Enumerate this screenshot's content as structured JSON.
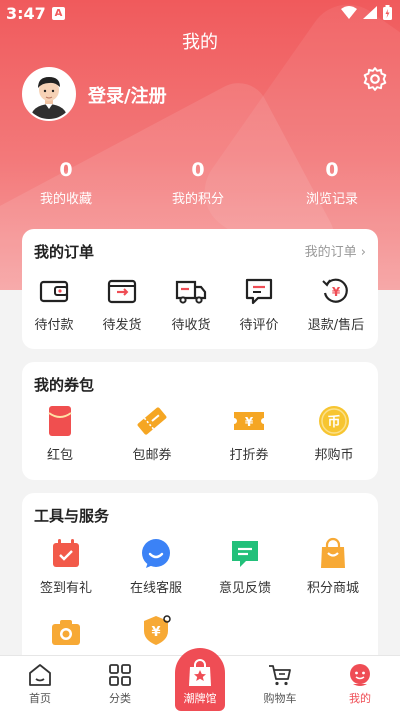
{
  "status_bar": {
    "time": "3:47",
    "notification_badge": "A"
  },
  "header": {
    "title": "我的",
    "login_text": "登录/注册"
  },
  "stats": [
    {
      "value": "0",
      "label": "我的收藏"
    },
    {
      "value": "0",
      "label": "我的积分"
    },
    {
      "value": "0",
      "label": "浏览记录"
    }
  ],
  "orders": {
    "title": "我的订单",
    "more": "我的订单",
    "items": [
      {
        "label": "待付款",
        "icon": "wallet-icon"
      },
      {
        "label": "待发货",
        "icon": "box-icon"
      },
      {
        "label": "待收货",
        "icon": "truck-icon"
      },
      {
        "label": "待评价",
        "icon": "comment-icon"
      },
      {
        "label": "退款/售后",
        "icon": "refund-icon"
      }
    ]
  },
  "coupons": {
    "title": "我的券包",
    "items": [
      {
        "label": "红包",
        "icon": "red-packet-icon"
      },
      {
        "label": "包邮券",
        "icon": "shipping-coupon-icon"
      },
      {
        "label": "打折券",
        "icon": "discount-coupon-icon"
      },
      {
        "label": "邦购币",
        "icon": "coin-icon",
        "glyph": "币"
      }
    ]
  },
  "tools": {
    "title": "工具与服务",
    "items": [
      {
        "label": "签到有礼",
        "icon": "calendar-icon"
      },
      {
        "label": "在线客服",
        "icon": "chat-icon"
      },
      {
        "label": "意见反馈",
        "icon": "feedback-icon"
      },
      {
        "label": "积分商城",
        "icon": "shopping-bag-icon"
      },
      {
        "label": "",
        "icon": "camera-icon"
      },
      {
        "label": "",
        "icon": "yuan-badge-icon"
      }
    ]
  },
  "tabbar": {
    "items": [
      {
        "label": "首页",
        "icon": "home-icon"
      },
      {
        "label": "分类",
        "icon": "grid-icon"
      },
      {
        "label": "潮牌馆",
        "icon": "star-bag-icon"
      },
      {
        "label": "购物车",
        "icon": "cart-icon"
      },
      {
        "label": "我的",
        "icon": "profile-icon"
      }
    ]
  },
  "colors": {
    "accent": "#ef4d55",
    "hero_top": "#f05a5c",
    "background": "#f3f3f3"
  }
}
